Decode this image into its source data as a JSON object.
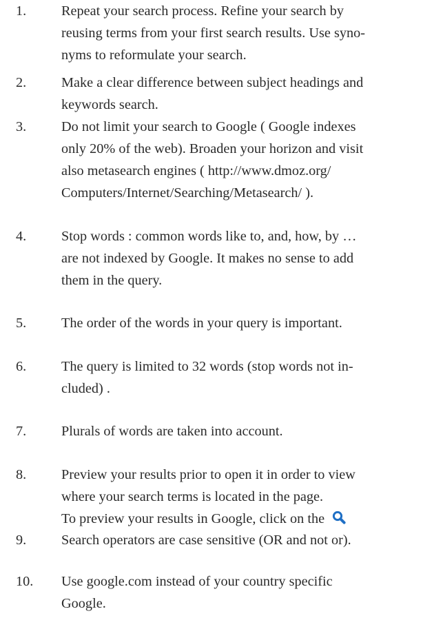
{
  "tips": [
    {
      "number": "1.",
      "lines": [
        "Repeat your search process. Refine your search by",
        "reusing terms from your first search results. Use syno-",
        "nyms to reformulate your search."
      ]
    },
    {
      "number": "2.",
      "lines": [
        "Make a clear difference between subject headings and",
        "keywords search."
      ]
    },
    {
      "number": "3.",
      "lines": [
        "Do not limit your search to Google ( Google indexes",
        "only 20% of the web). Broaden your horizon and visit",
        "also metasearch engines ( http://www.dmoz.org/",
        "Computers/Internet/Searching/Metasearch/ )."
      ]
    },
    {
      "number": "4.",
      "lines": [
        "Stop words : common words like to, and, how, by …",
        "are not indexed by Google. It makes no sense to add",
        "them in the query."
      ]
    },
    {
      "number": "5.",
      "lines": [
        "The order of the words in your query is important."
      ]
    },
    {
      "number": "6.",
      "lines": [
        "The query is limited to 32 words (stop words not in-",
        "cluded) ."
      ]
    },
    {
      "number": "7.",
      "lines": [
        "Plurals of words are taken into account."
      ]
    },
    {
      "number": "8.",
      "lines": [
        "Preview your results prior to open it in order to view",
        "where your search terms is located in the page.",
        "To preview your results in Google, click on the"
      ],
      "inline_icon": "magnifier-search-icon"
    },
    {
      "number": "9.",
      "lines": [
        "Search operators are case sensitive (OR and not or)."
      ]
    },
    {
      "number": "10.",
      "lines": [
        "Use google.com instead of your country specific",
        "Google."
      ]
    }
  ],
  "colors": {
    "text": "#2b2b2b",
    "icon": "#1f6fc5"
  }
}
